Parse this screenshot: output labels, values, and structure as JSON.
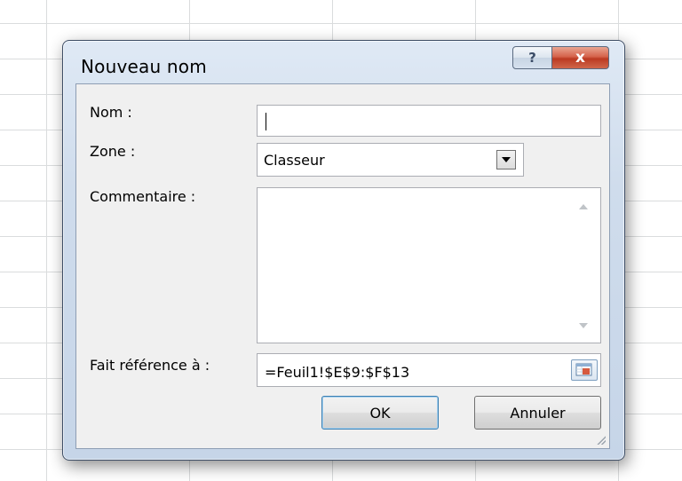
{
  "dialog": {
    "title": "Nouveau nom",
    "help_button": "?",
    "close_button": "x"
  },
  "form": {
    "name_label": "Nom :",
    "name_value": "",
    "scope_label": "Zone :",
    "scope_selected": "Classeur",
    "comment_label": "Commentaire :",
    "comment_value": "",
    "refers_label": "Fait référence à :",
    "refers_value": "=Feuil1!$E$9:$F$13"
  },
  "buttons": {
    "ok_label": "OK",
    "cancel_label": "Annuler"
  },
  "icons": {
    "scroll_up": "scroll-up-arrow",
    "scroll_down": "scroll-down-arrow",
    "dropdown": "chevron-down",
    "range_select": "collapse-dialog"
  }
}
